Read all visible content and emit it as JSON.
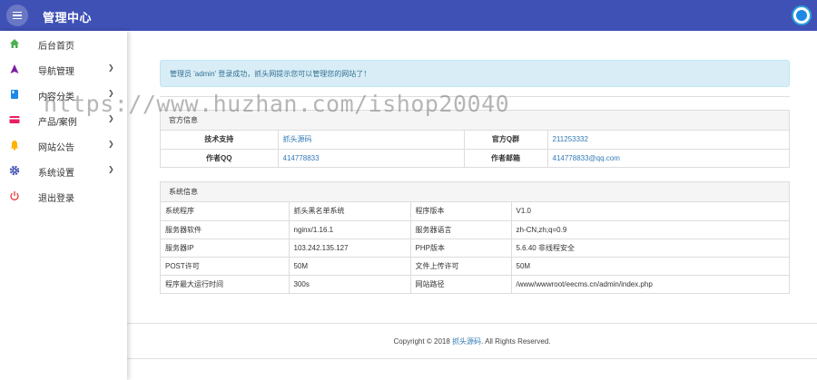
{
  "header": {
    "title": "管理中心"
  },
  "sidebar": {
    "items": [
      {
        "label": "后台首页",
        "icon": "home-icon",
        "color": "#4caf50",
        "expandable": false
      },
      {
        "label": "导航管理",
        "icon": "navigation-icon",
        "color": "#7b1fa2",
        "expandable": true
      },
      {
        "label": "内容分类",
        "icon": "book-icon",
        "color": "#1e88e5",
        "expandable": true
      },
      {
        "label": "产品/案例",
        "icon": "card-icon",
        "color": "#e91e63",
        "expandable": true
      },
      {
        "label": "网站公告",
        "icon": "bell-icon",
        "color": "#ffb300",
        "expandable": true
      },
      {
        "label": "系统设置",
        "icon": "gear-icon",
        "color": "#3f51b5",
        "expandable": true
      },
      {
        "label": "退出登录",
        "icon": "power-icon",
        "color": "#e53935",
        "expandable": false
      }
    ]
  },
  "alert": {
    "text": "管理员 'admin' 登录成功，抓头网提示您可以管理您的网站了！"
  },
  "official": {
    "title": "官方信息",
    "rows": [
      [
        "技术支持",
        "抓头源码",
        "官方Q群",
        "211253332"
      ],
      [
        "作者QQ",
        "414778833",
        "作者邮箱",
        "414778833@qq.com"
      ]
    ]
  },
  "system": {
    "title": "系统信息",
    "rows": [
      [
        "系统程序",
        "抓头黑名单系统",
        "程序版本",
        "V1.0"
      ],
      [
        "服务器软件",
        "nginx/1.16.1",
        "服务器语言",
        "zh-CN,zh;q=0.9"
      ],
      [
        "服务器IP",
        "103.242.135.127",
        "PHP版本",
        "5.6.40 非线程安全"
      ],
      [
        "POST许可",
        "50M",
        "文件上传许可",
        "50M"
      ],
      [
        "程序最大运行时间",
        "300s",
        "网站路径",
        "/www/wwwroot/eecms.cn/admin/index.php"
      ]
    ]
  },
  "footer": {
    "prefix": "Copyright © 2018 ",
    "link": "抓头源码",
    "suffix": ". All Rights Reserved."
  },
  "watermark": "https://www.huzhan.com/ishop20040"
}
